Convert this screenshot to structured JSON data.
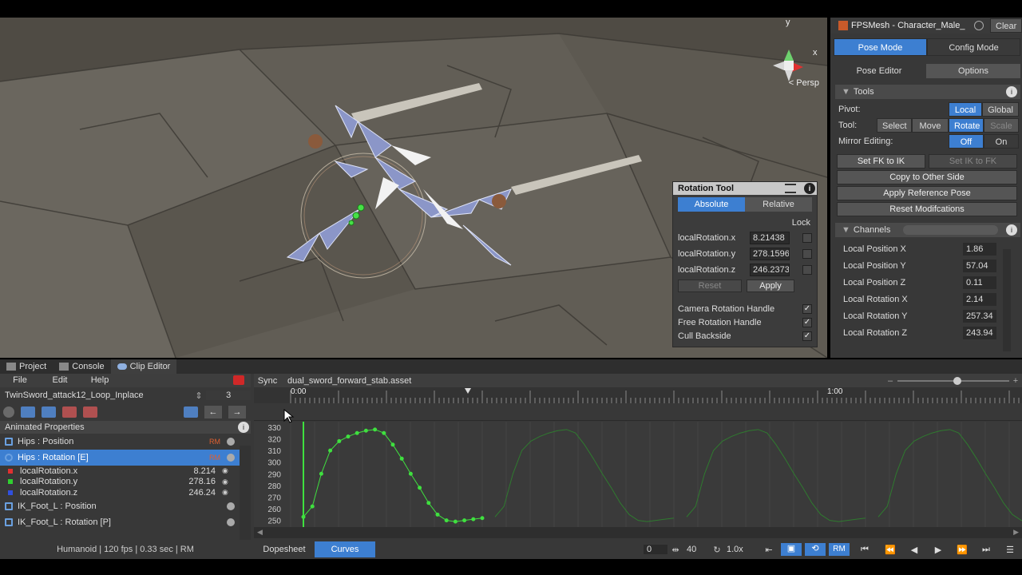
{
  "scene": {
    "persp_label": "< Persp",
    "gizmo_x": "x",
    "gizmo_y": "y",
    "colors": {
      "ground": "#5a564e",
      "rock": "#66625a",
      "bone": "#8b96c8",
      "accent": "#3d7fd1"
    }
  },
  "rotation_tool": {
    "title": "Rotation Tool",
    "mode_absolute": "Absolute",
    "mode_relative": "Relative",
    "lock_label": "Lock",
    "fields": [
      {
        "label": "localRotation.x",
        "value": "8.21438"
      },
      {
        "label": "localRotation.y",
        "value": "278.1596"
      },
      {
        "label": "localRotation.z",
        "value": "246.2373"
      }
    ],
    "reset_label": "Reset",
    "apply_label": "Apply",
    "options": [
      {
        "label": "Camera Rotation Handle",
        "checked": "✓"
      },
      {
        "label": "Free Rotation Handle",
        "checked": "✓"
      },
      {
        "label": "Cull Backside",
        "checked": "✓"
      }
    ]
  },
  "inspector": {
    "object_name": "FPSMesh - Character_Male_",
    "clear_label": "Clear",
    "pose_mode": "Pose Mode",
    "config_mode": "Config Mode",
    "tab_pose_editor": "Pose Editor",
    "tab_options": "Options",
    "tools_header": "Tools",
    "pivot_label": "Pivot:",
    "pivot_local": "Local",
    "pivot_global": "Global",
    "tool_label": "Tool:",
    "tool_select": "Select",
    "tool_move": "Move",
    "tool_rotate": "Rotate",
    "tool_scale": "Scale",
    "mirror_label": "Mirror Editing:",
    "mirror_off": "Off",
    "mirror_on": "On",
    "set_fk_ik": "Set FK to IK",
    "set_ik_fk": "Set IK to FK",
    "copy_other": "Copy to Other Side",
    "apply_ref": "Apply Reference Pose",
    "reset_mod": "Reset Modifcations",
    "channels_header": "Channels",
    "channels": [
      {
        "label": "Local Position X",
        "value": "1.86"
      },
      {
        "label": "Local Position Y",
        "value": "57.04"
      },
      {
        "label": "Local Position Z",
        "value": "0.11"
      },
      {
        "label": "Local Rotation X",
        "value": "2.14"
      },
      {
        "label": "Local Rotation Y",
        "value": "257.34"
      },
      {
        "label": "Local Rotation Z",
        "value": "243.94"
      }
    ]
  },
  "bottom": {
    "tabs": [
      "Project",
      "Console",
      "Clip Editor"
    ],
    "menu": [
      "File",
      "Edit",
      "Help"
    ],
    "clip_name": "TwinSword_attack12_Loop_Inplace",
    "frame": "3",
    "sync_label": "Sync",
    "asset_name": "dual_sword_forward_stab.asset",
    "animated_properties": "Animated Properties",
    "props": [
      {
        "label": "Hips : Position",
        "badge": "RM"
      },
      {
        "label": "Hips : Rotation [E]",
        "badge": "RM"
      },
      {
        "label": "IK_Foot_L : Position",
        "badge": ""
      },
      {
        "label": "IK_Foot_L : Rotation [P]",
        "badge": ""
      }
    ],
    "subprops": [
      {
        "label": "localRotation.x",
        "value": "8.214",
        "color": "#e03030"
      },
      {
        "label": "localRotation.y",
        "value": "278.16",
        "color": "#30d030"
      },
      {
        "label": "localRotation.z",
        "value": "246.24",
        "color": "#3050e0"
      }
    ],
    "status": "Humanoid | 120 fps | 0.33 sec | RM",
    "dopesheet": "Dopesheet",
    "curves": "Curves",
    "range_start": "0",
    "range_end": "40",
    "speed": "1.0x",
    "rm_label": "RM",
    "time_start": "0:00",
    "time_end": "1:00",
    "y_ticks": [
      "330",
      "320",
      "310",
      "300",
      "290",
      "280",
      "270",
      "260",
      "250"
    ]
  },
  "chart_data": {
    "type": "line",
    "series": [
      {
        "name": "localRotation.y",
        "x": [
          0,
          2,
          4,
          6,
          8,
          10,
          12,
          14,
          16,
          18,
          20,
          22,
          24,
          26,
          28,
          30,
          32,
          34,
          36,
          38,
          40
        ],
        "values": [
          253,
          262,
          290,
          310,
          318,
          322,
          325,
          327,
          328,
          325,
          315,
          303,
          290,
          278,
          265,
          255,
          250,
          249,
          250,
          251,
          252
        ]
      }
    ],
    "ylim": [
      247,
      332
    ],
    "xlabel": "",
    "ylabel": ""
  }
}
